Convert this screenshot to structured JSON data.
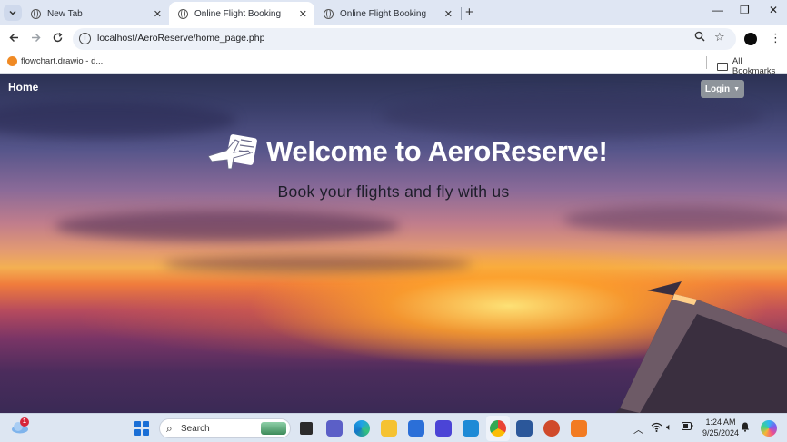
{
  "browser": {
    "tabs": [
      {
        "label": "New Tab",
        "active": false
      },
      {
        "label": "Online Flight Booking",
        "active": true
      },
      {
        "label": "Online Flight Booking",
        "active": false
      }
    ],
    "new_tab_symbol": "+",
    "close_symbol": "✕",
    "window_controls": {
      "minimize": "—",
      "restore": "❐",
      "close": "✕"
    },
    "address": "localhost/AeroReserve/home_page.php",
    "bookmarks": [
      {
        "label": "flowchart.drawio - d...",
        "icon": "drawio-icon"
      }
    ],
    "all_bookmarks_label": "All Bookmarks"
  },
  "page": {
    "nav": {
      "home_label": "Home",
      "login_label": "Login"
    },
    "hero": {
      "title": "Welcome to AeroReserve!",
      "subtitle": "Book your flights and fly with us",
      "icon": "airplane-ticket-icon"
    },
    "colors": {
      "login_button": "#8e949b",
      "title": "#ffffff",
      "subtitle": "#1e1e2a"
    }
  },
  "taskbar": {
    "weather_badge": "1",
    "search_label": "Search",
    "apps": [
      "task-view-icon",
      "teams-icon",
      "edge-icon",
      "file-explorer-icon",
      "store-icon",
      "vscode-alt-icon",
      "vscode-icon",
      "chrome-icon",
      "word-icon",
      "powerpoint-icon",
      "xampp-icon"
    ],
    "time": "1:24 AM",
    "date": "9/25/2024"
  }
}
